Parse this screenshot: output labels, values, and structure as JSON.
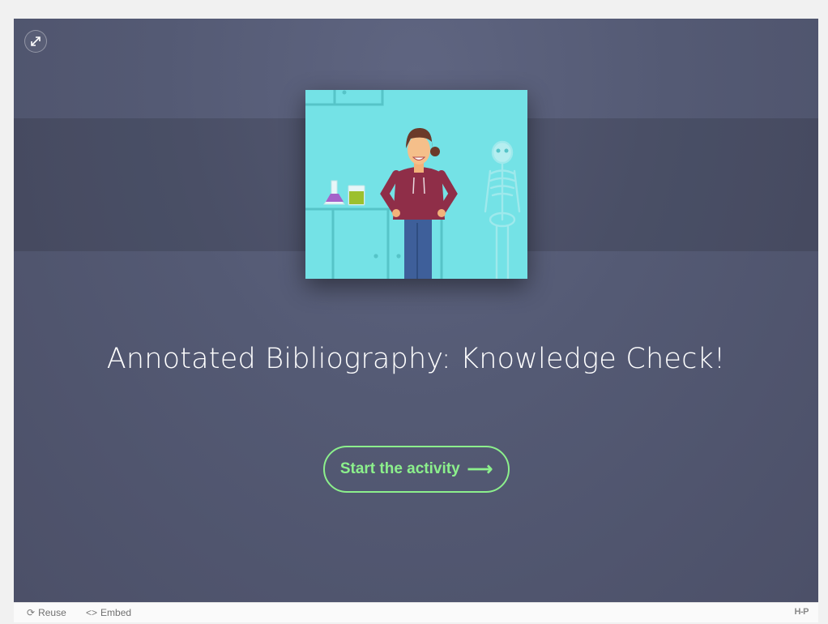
{
  "app": {
    "title": "Annotated Bibliography: Knowledge Check!",
    "start_button": {
      "label": "Start the activity",
      "arrow": "⟶"
    },
    "fullscreen": {
      "icon": "fullscreen-expand-icon"
    }
  },
  "footer": {
    "reuse": {
      "icon": "⟳",
      "label": "Reuse"
    },
    "embed": {
      "icon": "<>",
      "label": "Embed"
    },
    "logo": "H-P"
  },
  "colors": {
    "background": "#545a74",
    "accent": "#8cf08c",
    "hero_background": "#74e2e6"
  }
}
